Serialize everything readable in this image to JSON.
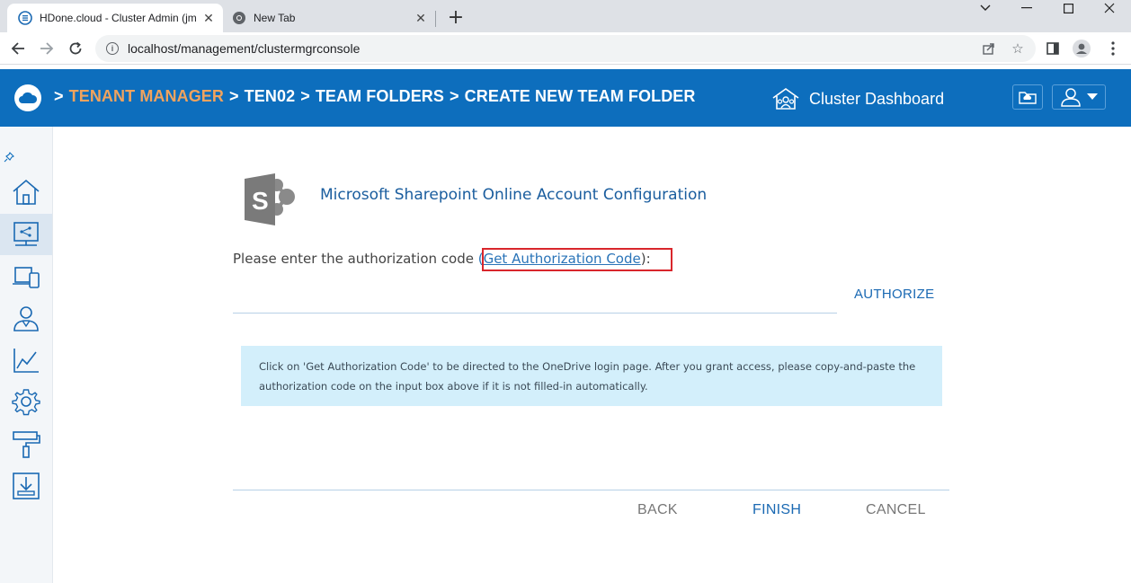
{
  "browser": {
    "tabs": [
      {
        "title": "HDone.cloud - Cluster Admin (jm",
        "active": true
      },
      {
        "title": "New Tab",
        "active": false
      }
    ],
    "url": "localhost/management/clustermgrconsole"
  },
  "header": {
    "breadcrumb": [
      {
        "label": "TENANT MANAGER",
        "accent": true
      },
      {
        "label": "TEN02"
      },
      {
        "label": "TEAM FOLDERS"
      },
      {
        "label": "CREATE NEW TEAM FOLDER"
      }
    ],
    "separator": ">",
    "cluster_dashboard": "Cluster Dashboard"
  },
  "sidebar": {
    "items": [
      {
        "icon": "home-icon"
      },
      {
        "icon": "team-folders-icon",
        "active": true
      },
      {
        "icon": "devices-icon"
      },
      {
        "icon": "users-icon"
      },
      {
        "icon": "reports-icon"
      },
      {
        "icon": "settings-icon"
      },
      {
        "icon": "branding-icon"
      },
      {
        "icon": "download-icon"
      }
    ]
  },
  "main": {
    "title": "Microsoft Sharepoint Online Account Configuration",
    "prompt_prefix": "Please enter the authorization code ",
    "prompt_open": "(",
    "auth_link": "Get Authorization Code",
    "prompt_close": "):",
    "auth_input_value": "",
    "authorize_label": "AUTHORIZE",
    "info_text": "Click on 'Get Authorization Code' to be directed to the OneDrive login page. After you grant access, please copy-and-paste the authorization code on the input box above if it is not filled-in automatically.",
    "back_label": "BACK",
    "finish_label": "FINISH",
    "cancel_label": "CANCEL"
  },
  "colors": {
    "header_bg": "#0d6ebd",
    "accent_crumb": "#f0a35e",
    "info_bg": "#d3effb",
    "highlight": "#d9262c"
  }
}
